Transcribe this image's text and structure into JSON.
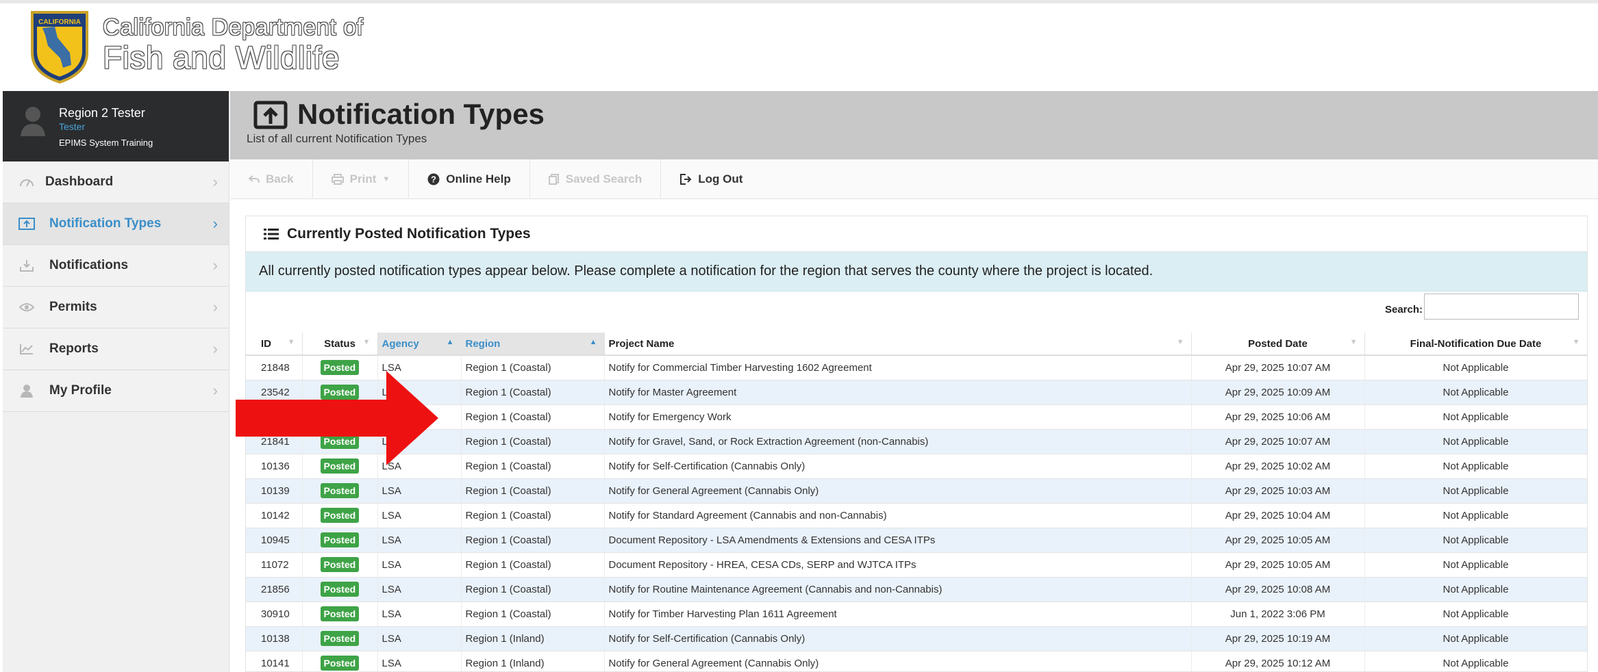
{
  "header": {
    "logo_text": "CALIFORNIA FISH & WILDLIFE",
    "brand_line1": "California Department of",
    "brand_line2": "Fish and Wildlife"
  },
  "user": {
    "name": "Region 2 Tester",
    "role": "Tester",
    "environment": "EPIMS System Training"
  },
  "sidebar": {
    "items": [
      {
        "label": "Dashboard",
        "icon": "speedometer-icon",
        "active": false
      },
      {
        "label": "Notification Types",
        "icon": "upload-screen-icon",
        "active": true
      },
      {
        "label": "Notifications",
        "icon": "download-tray-icon",
        "active": false
      },
      {
        "label": "Permits",
        "icon": "eye-icon",
        "active": false
      },
      {
        "label": "Reports",
        "icon": "line-chart-icon",
        "active": false
      },
      {
        "label": "My Profile",
        "icon": "user-icon",
        "active": false
      }
    ]
  },
  "page": {
    "title": "Notification Types",
    "subtitle": "List of all current Notification Types"
  },
  "toolbar": {
    "back": "Back",
    "print": "Print",
    "help": "Online Help",
    "saved_search": "Saved Search",
    "logout": "Log Out"
  },
  "panel": {
    "title": "Currently Posted Notification Types",
    "info": "All currently posted notification types appear below. Please complete a notification for the region that serves the county where the project is located.",
    "search_label": "Search:",
    "search_value": ""
  },
  "table": {
    "columns": [
      "ID",
      "Status",
      "Agency",
      "Region",
      "Project Name",
      "Posted Date",
      "Final-Notification Due Date"
    ],
    "rows": [
      {
        "id": "21848",
        "status": "Posted",
        "agency": "LSA",
        "region": "Region 1 (Coastal)",
        "project": "Notify for Commercial Timber Harvesting 1602 Agreement",
        "posted": "Apr 29, 2025 10:07 AM",
        "due": "Not Applicable"
      },
      {
        "id": "23542",
        "status": "Posted",
        "agency": "LSA",
        "region": "Region 1 (Coastal)",
        "project": "Notify for Master Agreement",
        "posted": "Apr 29, 2025 10:09 AM",
        "due": "Not Applicable"
      },
      {
        "id": "",
        "status": "",
        "agency": "",
        "region": "Region 1 (Coastal)",
        "project": "Notify for Emergency Work",
        "posted": "Apr 29, 2025 10:06 AM",
        "due": "Not Applicable"
      },
      {
        "id": "21841",
        "status": "Posted",
        "agency": "LSA",
        "region": "Region 1 (Coastal)",
        "project": "Notify for Gravel, Sand, or Rock Extraction Agreement (non-Cannabis)",
        "posted": "Apr 29, 2025 10:07 AM",
        "due": "Not Applicable"
      },
      {
        "id": "10136",
        "status": "Posted",
        "agency": "LSA",
        "region": "Region 1 (Coastal)",
        "project": "Notify for Self-Certification (Cannabis Only)",
        "posted": "Apr 29, 2025 10:02 AM",
        "due": "Not Applicable"
      },
      {
        "id": "10139",
        "status": "Posted",
        "agency": "LSA",
        "region": "Region 1 (Coastal)",
        "project": "Notify for General Agreement (Cannabis Only)",
        "posted": "Apr 29, 2025 10:03 AM",
        "due": "Not Applicable"
      },
      {
        "id": "10142",
        "status": "Posted",
        "agency": "LSA",
        "region": "Region 1 (Coastal)",
        "project": "Notify for Standard Agreement (Cannabis and non-Cannabis)",
        "posted": "Apr 29, 2025 10:04 AM",
        "due": "Not Applicable"
      },
      {
        "id": "10945",
        "status": "Posted",
        "agency": "LSA",
        "region": "Region 1 (Coastal)",
        "project": "Document Repository - LSA Amendments & Extensions and CESA ITPs",
        "posted": "Apr 29, 2025 10:05 AM",
        "due": "Not Applicable"
      },
      {
        "id": "11072",
        "status": "Posted",
        "agency": "LSA",
        "region": "Region 1 (Coastal)",
        "project": "Document Repository - HREA, CESA CDs, SERP and WJTCA ITPs",
        "posted": "Apr 29, 2025 10:05 AM",
        "due": "Not Applicable"
      },
      {
        "id": "21856",
        "status": "Posted",
        "agency": "LSA",
        "region": "Region 1 (Coastal)",
        "project": "Notify for Routine Maintenance Agreement (Cannabis and non-Cannabis)",
        "posted": "Apr 29, 2025 10:08 AM",
        "due": "Not Applicable"
      },
      {
        "id": "30910",
        "status": "Posted",
        "agency": "LSA",
        "region": "Region 1 (Coastal)",
        "project": "Notify for Timber Harvesting Plan 1611 Agreement",
        "posted": "Jun 1, 2022 3:06 PM",
        "due": "Not Applicable"
      },
      {
        "id": "10138",
        "status": "Posted",
        "agency": "LSA",
        "region": "Region 1 (Inland)",
        "project": "Notify for Self-Certification (Cannabis Only)",
        "posted": "Apr 29, 2025 10:19 AM",
        "due": "Not Applicable"
      },
      {
        "id": "10141",
        "status": "Posted",
        "agency": "LSA",
        "region": "Region 1 (Inland)",
        "project": "Notify for General Agreement (Cannabis Only)",
        "posted": "Apr 29, 2025 10:12 AM",
        "due": "Not Applicable"
      }
    ]
  },
  "colors": {
    "accent": "#3a8fc9",
    "posted_badge": "#3ea346",
    "arrow": "#ee1111",
    "info_bar": "#dbeef4",
    "alt_row": "#e9f1fa"
  }
}
